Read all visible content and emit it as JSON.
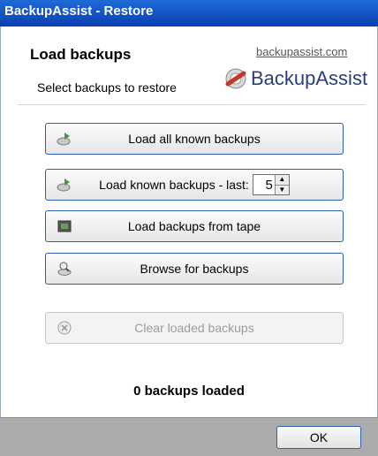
{
  "window": {
    "title": "BackupAssist - Restore"
  },
  "header": {
    "title": "Load backups",
    "subtitle": "Select backups to restore",
    "site_link": "backupassist.com",
    "logo_text": "BackupAssist"
  },
  "buttons": {
    "load_all": "Load all known backups",
    "load_known_last": "Load known backups - last:",
    "last_count": "5",
    "load_tape": "Load backups from tape",
    "browse": "Browse for backups",
    "clear": "Clear loaded backups"
  },
  "status": {
    "loaded_text": "0 backups loaded"
  },
  "footer": {
    "ok_label": "OK"
  },
  "colors": {
    "titlebar": "#0a3fb0",
    "accent_border": "#2e5fa8",
    "footer_bg": "#ababab"
  },
  "icons": {
    "load_all": "disk-arrow-icon",
    "load_known": "disk-arrow-icon",
    "tape": "tape-icon",
    "browse": "magnifier-disk-icon",
    "clear": "clear-x-icon",
    "logo": "backupassist-logo-icon"
  }
}
